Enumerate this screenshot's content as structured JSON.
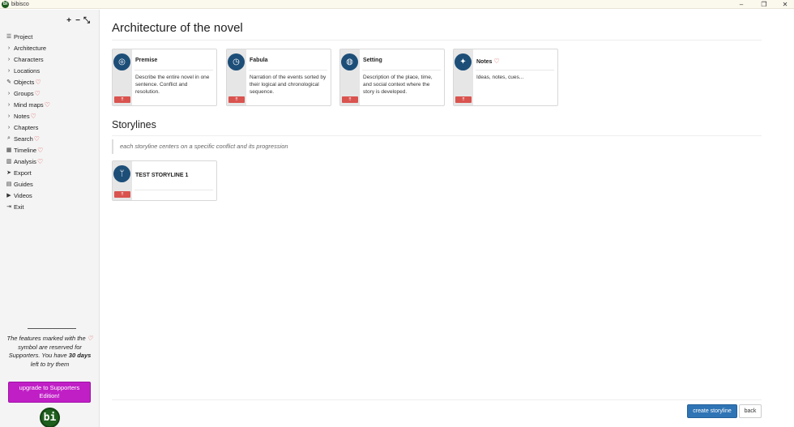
{
  "window": {
    "title": "bibisco",
    "icon_label": "bi",
    "minimize": "–",
    "restore": "❐",
    "close": "✕"
  },
  "sidebar": {
    "tree_controls": {
      "expand": "+",
      "collapse": "−",
      "fullscreen": "⤡"
    },
    "items": [
      {
        "label": "Project",
        "icon": "menu-icon",
        "glyph": "☰",
        "supporter": false
      },
      {
        "label": "Architecture",
        "icon": "chevron-right-icon",
        "glyph": "›",
        "supporter": false
      },
      {
        "label": "Characters",
        "icon": "chevron-right-icon",
        "glyph": "›",
        "supporter": false
      },
      {
        "label": "Locations",
        "icon": "chevron-right-icon",
        "glyph": "›",
        "supporter": false
      },
      {
        "label": "Objects",
        "icon": "pencil-icon",
        "glyph": "✎",
        "supporter": true
      },
      {
        "label": "Groups",
        "icon": "chevron-right-icon",
        "glyph": "›",
        "supporter": true
      },
      {
        "label": "Mind maps",
        "icon": "chevron-right-icon",
        "glyph": "›",
        "supporter": true
      },
      {
        "label": "Notes",
        "icon": "chevron-right-icon",
        "glyph": "›",
        "supporter": true
      },
      {
        "label": "Chapters",
        "icon": "chevron-right-icon",
        "glyph": "›",
        "supporter": false
      },
      {
        "label": "Search",
        "icon": "search-icon",
        "glyph": "⌕",
        "supporter": true
      },
      {
        "label": "Timeline",
        "icon": "calendar-icon",
        "glyph": "▦",
        "supporter": true
      },
      {
        "label": "Analysis",
        "icon": "bar-chart-icon",
        "glyph": "▥",
        "supporter": true
      },
      {
        "label": "Export",
        "icon": "send-icon",
        "glyph": "➤",
        "supporter": false
      },
      {
        "label": "Guides",
        "icon": "book-icon",
        "glyph": "▤",
        "supporter": false
      },
      {
        "label": "Videos",
        "icon": "video-icon",
        "glyph": "▶",
        "supporter": false
      },
      {
        "label": "Exit",
        "icon": "exit-icon",
        "glyph": "⇥",
        "supporter": false
      }
    ],
    "supporter_note": {
      "part1": "The features marked with the",
      "part2": "symbol are reserved for Supporters. You have",
      "days": "30 days",
      "part3": "left to try them"
    },
    "upgrade_label": "upgrade to Supporters Edition!",
    "logo_text": "bi"
  },
  "main": {
    "title": "Architecture of the novel",
    "cards": [
      {
        "title": "Premise",
        "icon": "compass-icon",
        "glyph": "◎",
        "description": "Describe the entire novel in one sentence. Conflict and resolution.",
        "supporter": false
      },
      {
        "title": "Fabula",
        "icon": "clock-icon",
        "glyph": "◷",
        "description": "Narration of the events sorted by their logical and chronological sequence.",
        "supporter": false
      },
      {
        "title": "Setting",
        "icon": "globe-icon",
        "glyph": "◍",
        "description": "Description of the place, time, and social context where the story is developed.",
        "supporter": false
      },
      {
        "title": "Notes",
        "icon": "pushpin-icon",
        "glyph": "✦",
        "description": "Ideas, notes, cues...",
        "supporter": true
      }
    ],
    "storylines_title": "Storylines",
    "storylines_subtitle": "each storyline centers on a specific conflict and its progression",
    "storylines": [
      {
        "title": "TEST STORYLINE 1",
        "icon": "branch-icon",
        "glyph": "ᛘ"
      }
    ],
    "handle_glyph": "⠿",
    "heart_glyph": "♡"
  },
  "footer": {
    "create_label": "create storyline",
    "back_label": "back"
  }
}
